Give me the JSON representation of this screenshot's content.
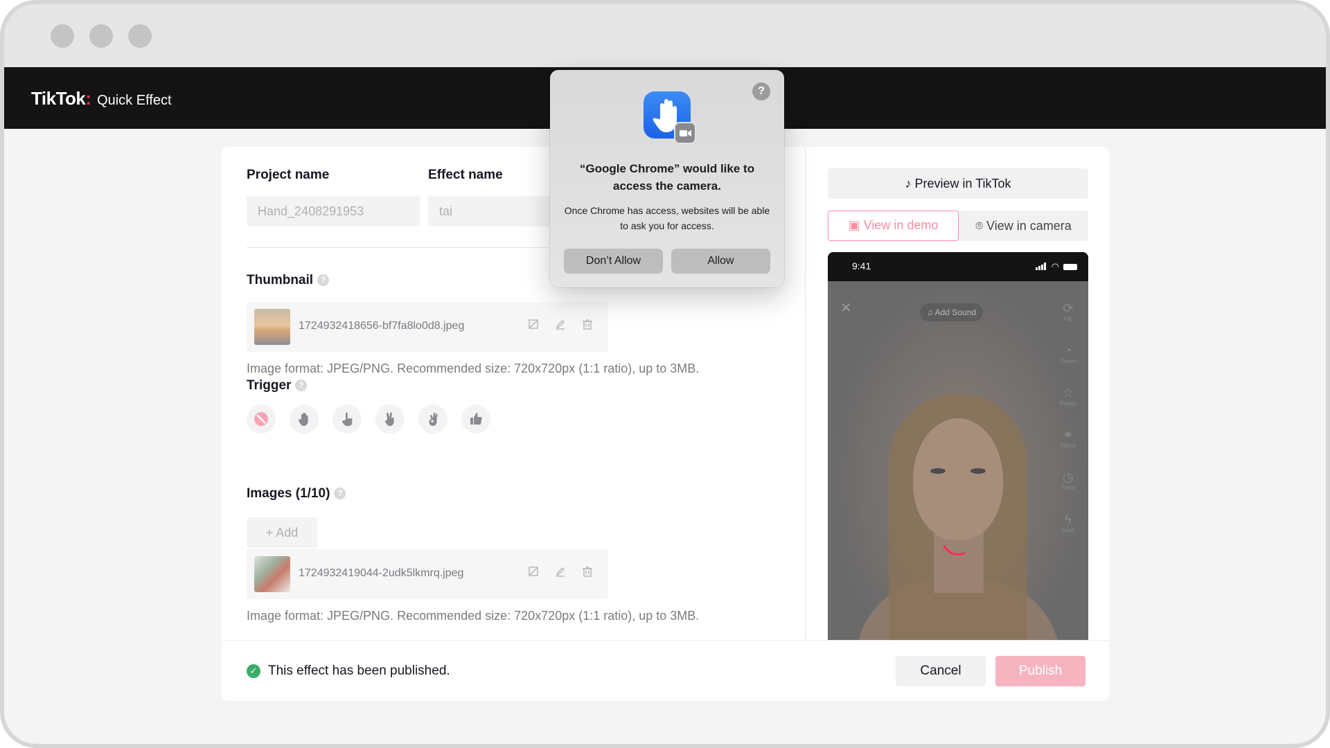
{
  "app": {
    "brand": "TikTok",
    "brand_dot": ":",
    "product": "Quick Effect"
  },
  "form": {
    "project_label": "Project name",
    "project_value": "Hand_2408291953",
    "effect_label": "Effect name",
    "effect_value": "tai",
    "thumbnail_label": "Thumbnail",
    "thumbnail_file": "1724932418656-bf7fa8lo0d8.jpeg",
    "thumbnail_hint": "Image format: JPEG/PNG. Recommended size: 720x720px (1:1 ratio), up to 3MB.",
    "trigger_label": "Trigger",
    "images_label": "Images (1/10)",
    "add_label": "+ Add",
    "image_file": "1724932419044-2udk5lkmrq.jpeg",
    "images_hint": "Image format: JPEG/PNG. Recommended size: 720x720px (1:1 ratio), up to 3MB.",
    "help_glyph": "?"
  },
  "preview": {
    "preview_button": "Preview in TikTok",
    "view_demo": "View in demo",
    "view_camera": "View in camera",
    "phone_time": "9:41",
    "add_sound": "Add Sound",
    "side_icons": [
      {
        "icon": "flip-icon",
        "label": "Flip"
      },
      {
        "icon": "speed-icon",
        "label": "Speed"
      },
      {
        "icon": "beauty-icon",
        "label": "Beauty"
      },
      {
        "icon": "filters-icon",
        "label": "Filters"
      },
      {
        "icon": "timer-icon",
        "label": "Timer"
      },
      {
        "icon": "flash-icon",
        "label": "Flash"
      }
    ]
  },
  "footer": {
    "status_text": "This effect has been published.",
    "cancel_label": "Cancel",
    "publish_label": "Publish"
  },
  "dialog": {
    "title": "“Google Chrome” would like to access the camera.",
    "body": "Once Chrome has access, websites will be able to ask you for access.",
    "deny_label": "Don’t Allow",
    "allow_label": "Allow",
    "help_glyph": "?"
  },
  "colors": {
    "accent": "#fe2c55",
    "success": "#3cab6a",
    "appbar": "#141414"
  }
}
